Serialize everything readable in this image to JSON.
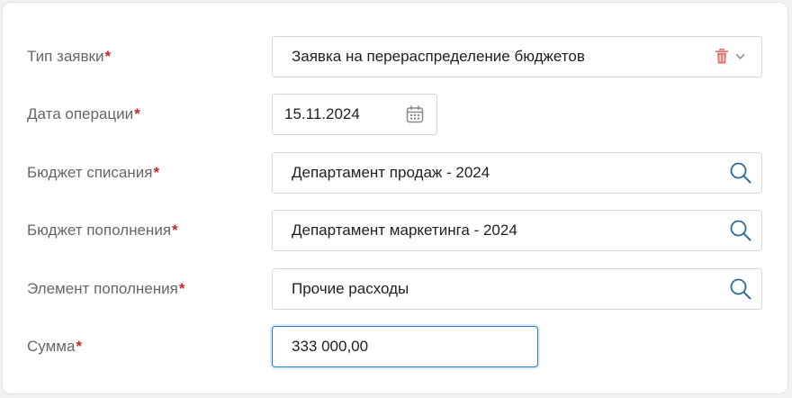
{
  "form": {
    "fields": [
      {
        "label": "Тип заявки",
        "required_mark": "*",
        "value": "Заявка на перераспределение бюджетов",
        "icons": [
          "trash-icon",
          "chevron-down-icon"
        ]
      },
      {
        "label": "Дата операции",
        "required_mark": "*",
        "value": "15.11.2024",
        "icons": [
          "calendar-icon"
        ]
      },
      {
        "label": "Бюджет списания",
        "required_mark": "*",
        "value": "Департамент продаж - 2024",
        "icons": [
          "search-icon"
        ]
      },
      {
        "label": "Бюджет пополнения",
        "required_mark": "*",
        "value": "Департамент маркетинга - 2024",
        "icons": [
          "search-icon"
        ]
      },
      {
        "label": "Элемент пополнения",
        "required_mark": "*",
        "value": "Прочие расходы",
        "icons": [
          "search-icon"
        ]
      },
      {
        "label": "Сумма",
        "required_mark": "*",
        "value": "333 000,00",
        "icons": []
      }
    ]
  },
  "colors": {
    "label": "#666666",
    "required": "#c62828",
    "value_text": "#1f1f1f",
    "field_border": "#d6d6d6",
    "focus_border": "#2a7fd1",
    "icon_accent": "#2e6a96",
    "trash": "#e06a6a",
    "icon_gray": "#8a8a8a"
  }
}
